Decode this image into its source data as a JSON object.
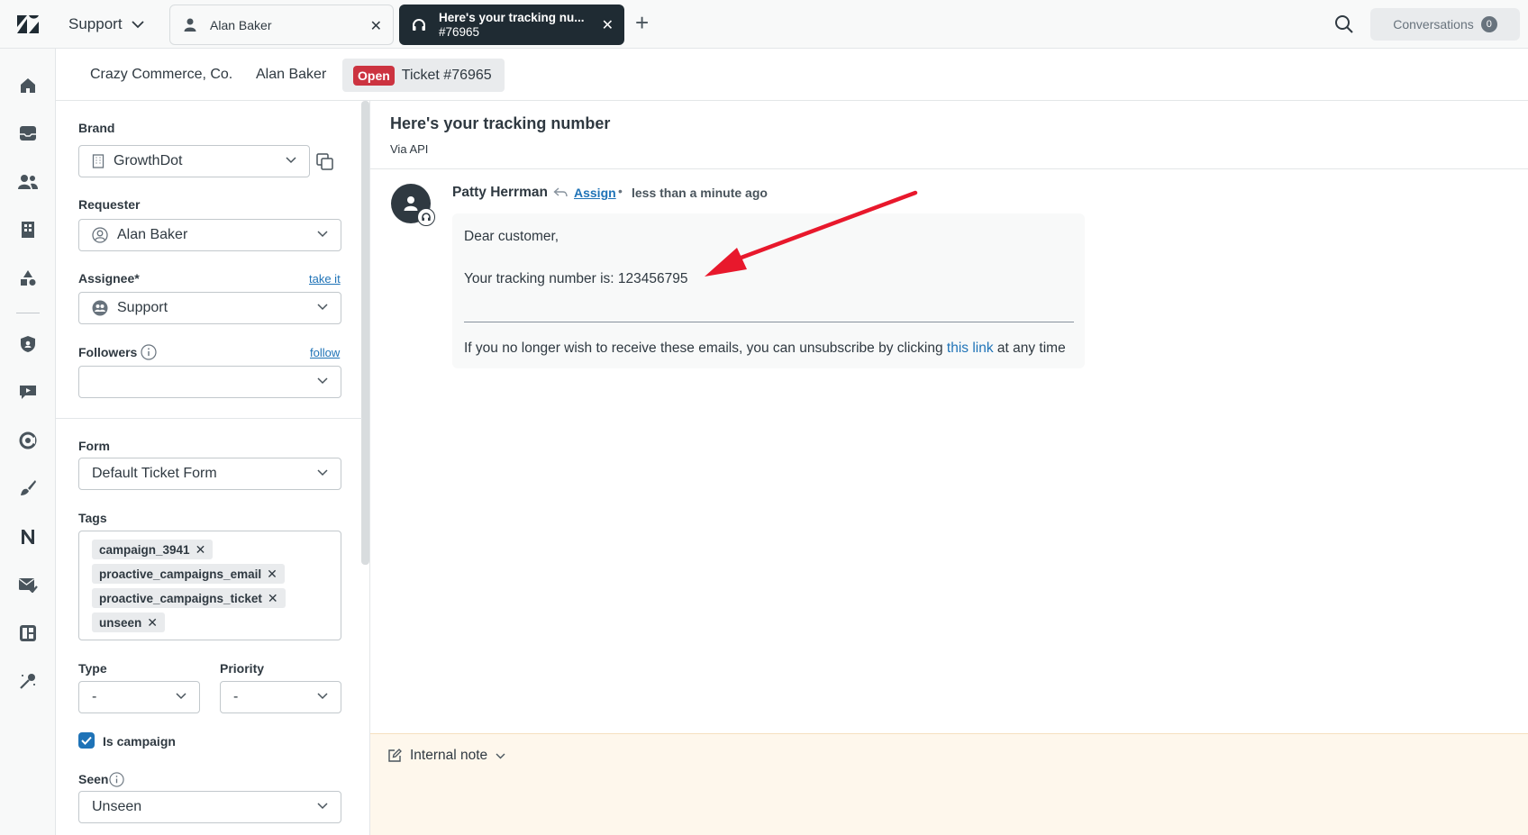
{
  "topbar": {
    "product": "Support",
    "tabs": [
      {
        "title": "Alan Baker",
        "icon": "user-icon"
      },
      {
        "title": "Here's your tracking nu...",
        "subtitle": "#76965",
        "icon": "headset-icon"
      }
    ],
    "conversations_label": "Conversations",
    "conversations_count": "0"
  },
  "breadcrumb": {
    "org": "Crazy Commerce, Co.",
    "user": "Alan Baker",
    "status": "Open",
    "ticket": "Ticket #76965"
  },
  "props": {
    "brand_label": "Brand",
    "brand_value": "GrowthDot",
    "requester_label": "Requester",
    "requester_value": "Alan Baker",
    "assignee_label": "Assignee*",
    "assignee_link": "take it",
    "assignee_value": "Support",
    "followers_label": "Followers",
    "followers_link": "follow",
    "followers_value": "",
    "form_label": "Form",
    "form_value": "Default Ticket Form",
    "tags_label": "Tags",
    "tags": [
      "campaign_3941",
      "proactive_campaigns_email",
      "proactive_campaigns_ticket",
      "unseen"
    ],
    "type_label": "Type",
    "type_value": "-",
    "priority_label": "Priority",
    "priority_value": "-",
    "campaign_label": "Is campaign",
    "campaign_checked": true,
    "seen_label": "Seen",
    "seen_value": "Unseen"
  },
  "ticket": {
    "subject": "Here's your tracking number",
    "via": "Via API",
    "message": {
      "author": "Patty Herrman",
      "assign_link": "Assign",
      "time": "less than a minute ago",
      "greeting": "Dear customer,",
      "body": "Your tracking number is: 123456795",
      "footer_prefix": "If you no longer wish to receive these emails, you can unsubscribe by clicking",
      "footer_link": "this link",
      "footer_suffix": "at any time"
    }
  },
  "composer": {
    "mode": "Internal note"
  },
  "colors": {
    "accent": "#1f73b7",
    "open_badge": "#cc3340",
    "dark_tab": "#1f2b33",
    "composer_bg": "#fef7ec",
    "annotation_arrow": "#e8182c"
  }
}
